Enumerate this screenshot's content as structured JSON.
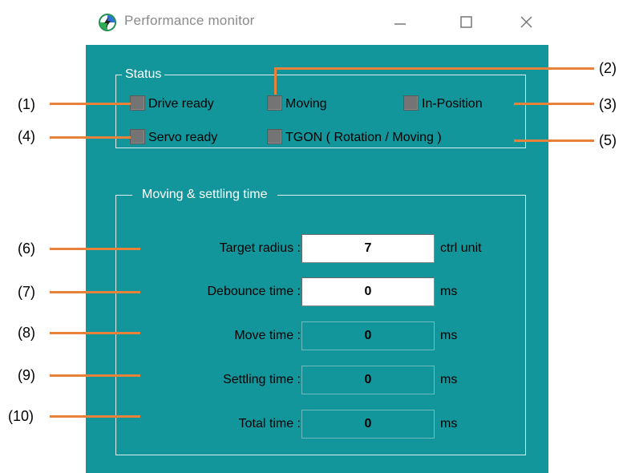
{
  "window": {
    "title": "Performance monitor",
    "minimize_label": "Minimize",
    "maximize_label": "Maximize",
    "close_label": "Close"
  },
  "status": {
    "title": "Status",
    "indicators": {
      "drive_ready": "Drive ready",
      "moving": "Moving",
      "in_position": "In-Position",
      "servo_ready": "Servo ready",
      "tgon": "TGON ( Rotation / Moving )"
    }
  },
  "timing": {
    "title": "Moving & settling time",
    "target_radius": {
      "label": "Target radius :",
      "value": "7",
      "unit": "ctrl unit"
    },
    "debounce_time": {
      "label": "Debounce time :",
      "value": "0",
      "unit": "ms"
    },
    "move_time": {
      "label": "Move time :",
      "value": "0",
      "unit": "ms"
    },
    "settling_time": {
      "label": "Settling time :",
      "value": "0",
      "unit": "ms"
    },
    "total_time": {
      "label": "Total time :",
      "value": "0",
      "unit": "ms"
    }
  },
  "callouts": [
    "(1)",
    "(2)",
    "(3)",
    "(4)",
    "(5)",
    "(6)",
    "(7)",
    "(8)",
    "(9)",
    "(10)"
  ],
  "colors": {
    "client_bg": "#12969b",
    "indicator_off": "#747474",
    "callout_line": "#e8823a"
  }
}
